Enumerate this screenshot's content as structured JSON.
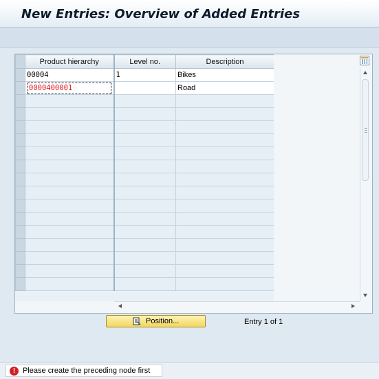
{
  "window": {
    "title": "New Entries: Overview of Added Entries"
  },
  "table": {
    "columns": [
      "Product hierarchy",
      "Level no.",
      "Description"
    ],
    "rows": [
      {
        "hierarchy": "00004",
        "level": "1",
        "description": "Bikes"
      },
      {
        "hierarchy": "0000400001",
        "level": "",
        "description": "Road"
      }
    ]
  },
  "footer": {
    "position_label": "Position...",
    "entry_info": "Entry 1 of 1"
  },
  "status": {
    "message": "Please create the preceding node first",
    "type": "error",
    "icon": "error-icon"
  },
  "colors": {
    "error": "#e0161d",
    "button": "#f4d75c",
    "header_bg": "#dbe5ed"
  }
}
